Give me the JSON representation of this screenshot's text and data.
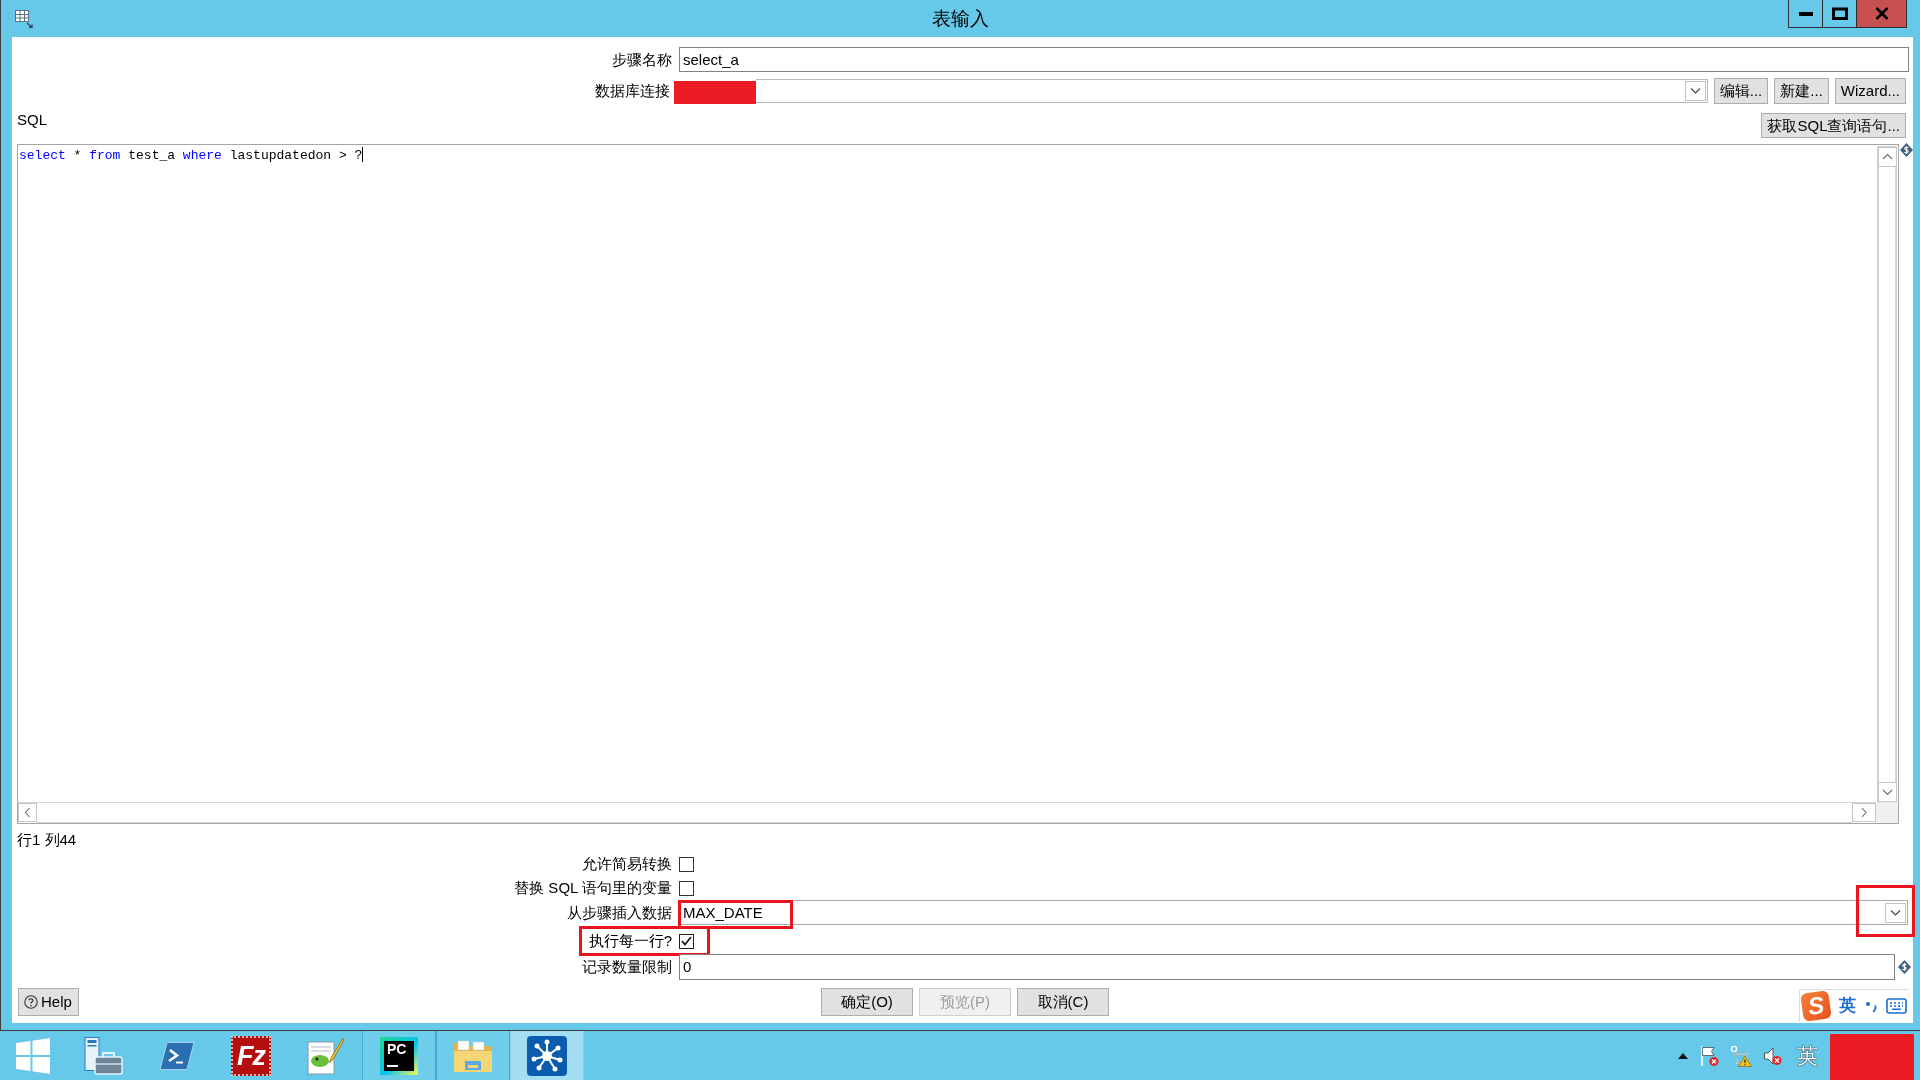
{
  "window": {
    "title": "表输入"
  },
  "step_name": {
    "label": "步骤名称",
    "value": "select_a"
  },
  "connection": {
    "label": "数据库连接",
    "redacted": true,
    "buttons": [
      "编辑...",
      "新建...",
      "Wizard..."
    ]
  },
  "sql": {
    "label": "SQL",
    "fetch_button": "获取SQL查询语句...",
    "tokens": [
      {
        "kind": "keyword",
        "text": "select"
      },
      {
        "kind": "plain",
        "text": " * "
      },
      {
        "kind": "keyword",
        "text": "from"
      },
      {
        "kind": "plain",
        "text": " test_a "
      },
      {
        "kind": "keyword",
        "text": "where"
      },
      {
        "kind": "plain",
        "text": " lastupdatedon > ?"
      }
    ],
    "status": "行1 列44"
  },
  "options": [
    {
      "kind": "checkbox",
      "label": "允许简易转换",
      "checked": false,
      "highlighted": false
    },
    {
      "kind": "checkbox",
      "label": "替换 SQL 语句里的变量",
      "checked": false,
      "highlighted": false
    },
    {
      "kind": "combo",
      "label": "从步骤插入数据",
      "value": "MAX_DATE",
      "highlighted": true,
      "arrow_highlighted": true
    },
    {
      "kind": "checkbox",
      "label": "执行每一行?",
      "checked": true,
      "highlighted": true
    },
    {
      "kind": "input",
      "label": "记录数量限制",
      "value": "0",
      "highlighted": false
    }
  ],
  "help_button": "Help",
  "dialog_buttons": [
    {
      "label": "确定(O)",
      "disabled": false
    },
    {
      "label": "预览(P)",
      "disabled": true
    },
    {
      "label": "取消(C)",
      "disabled": false
    }
  ],
  "ime": {
    "logo_letter": "S",
    "mode": "英"
  },
  "taskbar": {
    "apps": [
      {
        "kind": "start",
        "running": false,
        "selected": false
      },
      {
        "kind": "server-manager",
        "running": false,
        "selected": false
      },
      {
        "kind": "terminal",
        "running": false,
        "selected": false
      },
      {
        "kind": "ftp",
        "label": "Fz",
        "running": false,
        "selected": false
      },
      {
        "kind": "notepad",
        "running": false,
        "selected": false
      },
      {
        "kind": "ide",
        "label": "PC",
        "running": true,
        "selected": false
      },
      {
        "kind": "folder",
        "running": true,
        "selected": false
      },
      {
        "kind": "network",
        "running": true,
        "selected": true
      }
    ],
    "tray": {
      "language": "英",
      "clock_redacted": true
    }
  }
}
